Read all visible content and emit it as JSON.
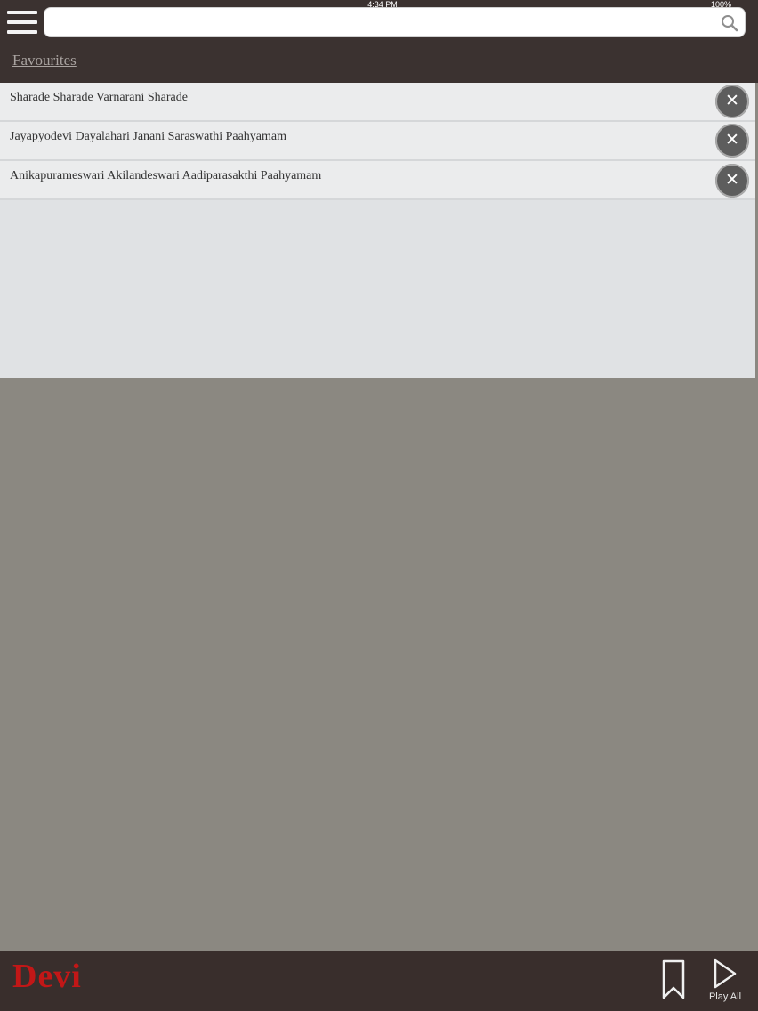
{
  "status_bar": {
    "time": "4:34 PM",
    "battery": "100%"
  },
  "header": {
    "search": {
      "value": "",
      "placeholder": ""
    },
    "breadcrumb": "Favourites"
  },
  "favorites": {
    "items": [
      {
        "label": "Sharade Sharade Varnarani Sharade"
      },
      {
        "label": "Jayapyodevi Dayalahari Janani Saraswathi Paahyamam"
      },
      {
        "label": "Anikapurameswari Akilandeswari Aadiparasakthi Paahyamam"
      }
    ],
    "remove_symbol": "✕"
  },
  "footer": {
    "logo": "Devi",
    "play_all_label": "Play All"
  },
  "colors": {
    "header_bg": "#3b3230",
    "footer_bg": "#392e2c",
    "logo_red": "#c21717",
    "list_bg": "#e0e2e4",
    "content_bg": "#8b8881"
  }
}
